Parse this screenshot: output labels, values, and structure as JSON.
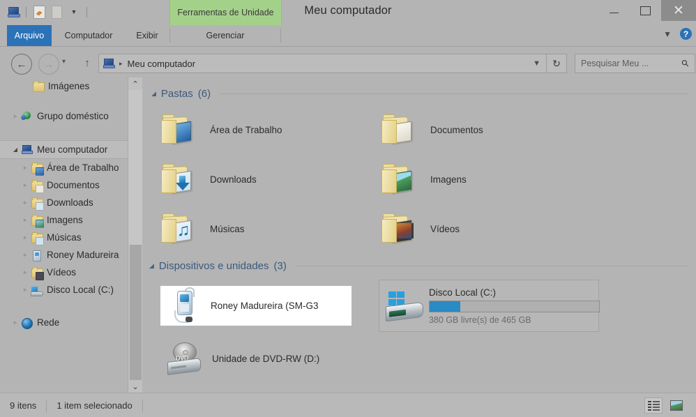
{
  "window": {
    "title": "Meu computador",
    "contextual_tab": "Ferramentas de Unidade",
    "minimize_label": "Minimizar",
    "maximize_label": "Maximizar",
    "close_label": "Fechar"
  },
  "quick_access": {
    "computer_icon": "computer-icon",
    "properties_icon": "properties-icon",
    "second_icon": "document-icon",
    "dropdown_icon": "chevron-down-icon"
  },
  "ribbon": {
    "tabs": [
      {
        "label": "Arquivo",
        "active": true
      },
      {
        "label": "Computador",
        "active": false
      },
      {
        "label": "Exibir",
        "active": false
      },
      {
        "label": "Gerenciar",
        "active": false
      }
    ],
    "collapse_icon": "chevron-down-icon",
    "help_icon": "help-icon",
    "help_glyph": "?"
  },
  "address": {
    "back_icon": "back-arrow-icon",
    "back_glyph": "←",
    "forward_icon": "forward-arrow-icon",
    "forward_glyph": "→",
    "recent_icon": "chevron-down-icon",
    "recent_glyph": "▾",
    "up_icon": "up-arrow-icon",
    "up_glyph": "↑",
    "crumb_icon": "computer-icon",
    "crumb_separator": "▸",
    "path": "Meu computador",
    "dropdown_glyph": "⌄",
    "refresh_icon": "refresh-icon",
    "refresh_glyph": "↻"
  },
  "search": {
    "placeholder": "Pesquisar Meu ...",
    "icon": "search-icon",
    "glyph": "⚲"
  },
  "sidebar": {
    "items": [
      {
        "label": "Imágenes",
        "icon": "folder-icon",
        "indent": 1,
        "twisty": "",
        "selected": false
      },
      {
        "label": "",
        "icon": "spacer",
        "indent": 0,
        "twisty": "",
        "selected": false
      },
      {
        "label": "Grupo doméstico",
        "icon": "homegroup-icon",
        "indent": 0,
        "twisty": "▹",
        "selected": false
      },
      {
        "label": "",
        "icon": "spacer",
        "indent": 0,
        "twisty": "",
        "selected": false
      },
      {
        "label": "Meu computador",
        "icon": "computer-icon",
        "indent": 0,
        "twisty": "◢",
        "selected": true
      },
      {
        "label": "Área de Trabalho",
        "icon": "folder-desktop-icon",
        "indent": 1,
        "twisty": "▹",
        "selected": false
      },
      {
        "label": "Documentos",
        "icon": "folder-documents-icon",
        "indent": 1,
        "twisty": "▹",
        "selected": false
      },
      {
        "label": "Downloads",
        "icon": "folder-downloads-icon",
        "indent": 1,
        "twisty": "▹",
        "selected": false
      },
      {
        "label": "Imagens",
        "icon": "folder-pictures-icon",
        "indent": 1,
        "twisty": "▹",
        "selected": false
      },
      {
        "label": "Músicas",
        "icon": "folder-music-icon",
        "indent": 1,
        "twisty": "▹",
        "selected": false
      },
      {
        "label": "Roney Madureira",
        "icon": "phone-icon",
        "indent": 1,
        "twisty": "▹",
        "selected": false
      },
      {
        "label": "Vídeos",
        "icon": "folder-videos-icon",
        "indent": 1,
        "twisty": "▹",
        "selected": false
      },
      {
        "label": "Disco Local (C:)",
        "icon": "drive-icon",
        "indent": 1,
        "twisty": "▹",
        "selected": false
      },
      {
        "label": "",
        "icon": "spacer",
        "indent": 0,
        "twisty": "",
        "selected": false
      },
      {
        "label": "Rede",
        "icon": "network-icon",
        "indent": 0,
        "twisty": "▹",
        "selected": false
      }
    ],
    "scroll_up_glyph": "⌃",
    "scroll_down_glyph": "⌄"
  },
  "content": {
    "groups": [
      {
        "title": "Pastas",
        "count": "(6)",
        "collapse_glyph": "◢"
      },
      {
        "title": "Dispositivos e unidades",
        "count": "(3)",
        "collapse_glyph": "◢"
      }
    ],
    "folders": [
      {
        "label": "Área de Trabalho",
        "icon": "folder-desktop-icon"
      },
      {
        "label": "Documentos",
        "icon": "folder-documents-icon"
      },
      {
        "label": "Downloads",
        "icon": "folder-downloads-icon"
      },
      {
        "label": "Imagens",
        "icon": "folder-pictures-icon"
      },
      {
        "label": "Músicas",
        "icon": "folder-music-icon"
      },
      {
        "label": "Vídeos",
        "icon": "folder-videos-icon"
      }
    ],
    "devices": {
      "phone": {
        "label": "Roney Madureira (SM-G3",
        "icon": "phone-device-icon",
        "selected": true
      },
      "local_disk": {
        "label": "Disco Local (C:)",
        "icon": "hard-drive-icon",
        "free_text": "380 GB livre(s) de 465 GB",
        "free_gb": 380,
        "total_gb": 465,
        "used_percent": 18,
        "bar_color": "#2a8ac4"
      },
      "dvd": {
        "label": "Unidade de DVD-RW (D:)",
        "icon": "dvd-drive-icon",
        "disc_text": "DVD"
      }
    }
  },
  "statusbar": {
    "item_count": "9 itens",
    "selection": "1 item selecionado",
    "view_details_icon": "details-view-icon",
    "view_icons_icon": "large-icons-view-icon"
  },
  "colors": {
    "accent_blue": "#2b72b8",
    "contextual_green": "#a4d18a",
    "group_heading": "#3a5a7d",
    "window_chrome": "#b4b4b4"
  }
}
